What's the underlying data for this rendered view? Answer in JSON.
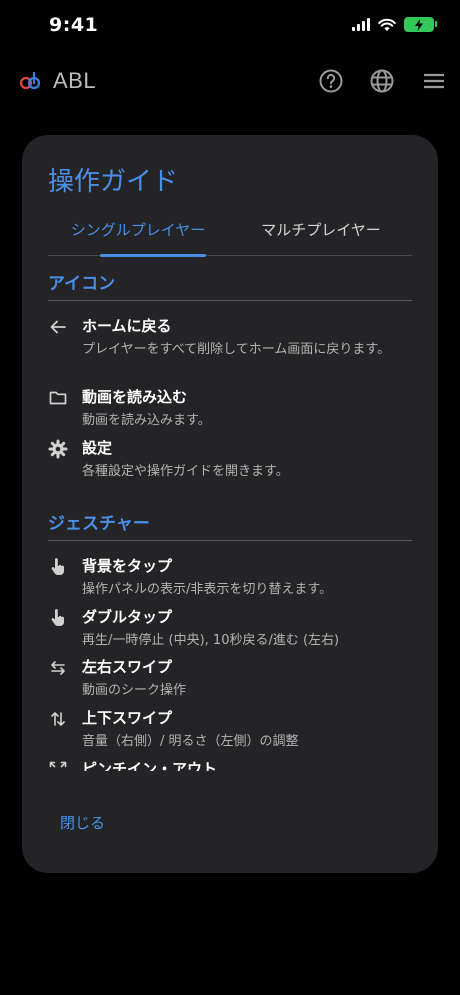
{
  "status": {
    "time": "9:41"
  },
  "app": {
    "title": "ABL",
    "logo_icon": "abl-logo-icon",
    "help_icon": "help-icon",
    "language_icon": "globe-icon",
    "menu_icon": "hamburger-menu-icon"
  },
  "dialog": {
    "title": "操作ガイド",
    "tabs": [
      {
        "label": "シングルプレイヤー",
        "selected": true
      },
      {
        "label": "マルチプレイヤー",
        "selected": false
      }
    ],
    "sections": [
      {
        "title": "アイコン",
        "items": [
          {
            "icon": "arrow-left-icon",
            "title": "ホームに戻る",
            "description": "プレイヤーをすべて削除してホーム画面に戻ります。"
          },
          {
            "icon": "folder-icon",
            "title": "動画を読み込む",
            "description": "動画を読み込みます。"
          },
          {
            "icon": "gear-icon",
            "title": "設定",
            "description": "各種設定や操作ガイドを開きます。"
          }
        ]
      },
      {
        "title": "ジェスチャー",
        "items": [
          {
            "icon": "tap-hand-icon",
            "title": "背景をタップ",
            "description": "操作パネルの表示/非表示を切り替えます。"
          },
          {
            "icon": "double-tap-hand-icon",
            "title": "ダブルタップ",
            "description": "再生/一時停止 (中央), 10秒戻る/進む (左右)"
          },
          {
            "icon": "swipe-horizontal-icon",
            "title": "左右スワイプ",
            "description": "動画のシーク操作"
          },
          {
            "icon": "swipe-vertical-icon",
            "title": "上下スワイプ",
            "description": "音量（右側）/ 明るさ（左側）の調整"
          },
          {
            "icon": "pinch-icon",
            "title": "ピンチイン・アウト",
            "description": ""
          }
        ]
      }
    ],
    "close_label": "閉じる"
  },
  "colors": {
    "accent": "#4a8fe7",
    "dialog_bg": "#242426",
    "battery": "#34c759"
  }
}
